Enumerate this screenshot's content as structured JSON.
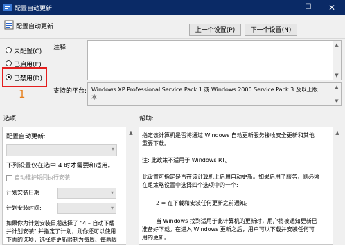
{
  "window": {
    "title": "配置自动更新",
    "min_glyph": "–",
    "max_glyph": "☐",
    "close_glyph": "✕"
  },
  "header": {
    "title": "配置自动更新",
    "prev_button": "上一个设置(P)",
    "next_button": "下一个设置(N)"
  },
  "radios": [
    {
      "label": "未配置(C)",
      "selected": false
    },
    {
      "label": "已启用(E)",
      "selected": false
    },
    {
      "label": "已禁用(D)",
      "selected": true
    }
  ],
  "annotation_number": "1",
  "comment_label": "注释:",
  "platform_label": "支持的平台:",
  "platform_text_line1": "Windows XP Professional Service Pack 1 或 Windows 2000 Service Pack 3 及以上版",
  "platform_text_line2": "本",
  "options_label": "选项:",
  "help_label": "帮助:",
  "options": {
    "configure_label": "配置自动更新:",
    "list_note": "下列设置仅在选中 4 时才需要和适用。",
    "maintenance_checkbox": "自动维护期间执行安装",
    "schedule_day_label": "计划安装日期:",
    "schedule_time_label": "计划安装时间:",
    "para_line1": "如果你为计划安装日期选择了 \"4 – 自动下载",
    "para_line2": "并计划安装\" 并指定了计划，则你还可以使用",
    "para_line3": "下面的选项，选择将更新限制为每周、每两周"
  },
  "help": {
    "p1_line1": "指定该计算机是否将通过 Windows 自动更新服务接收安全更新和其他",
    "p1_line2": "重要下载。",
    "p2": "注: 此政策不适用于 Windows RT。",
    "p3_line1": "此设置可指定是否在该计算机上启用自动更新。如果启用了服务，则必须",
    "p3_line2": "在组策略设置中选择四个选项中的一个:",
    "p4": "2 = 在下载和安装任何更新之前通知。",
    "p5_line1": "当 Windows 找到适用于此计算机的更新时，用户将被通知更新已",
    "p5_line2": "准备好下载。在进入 Windows 更新之后，用户可以下载并安装任何可",
    "p5_line3": "用的更新。"
  },
  "colors": {
    "titlebar": "#0a2a66",
    "highlight_border": "#e41e1e",
    "annotation": "#e6801e"
  }
}
